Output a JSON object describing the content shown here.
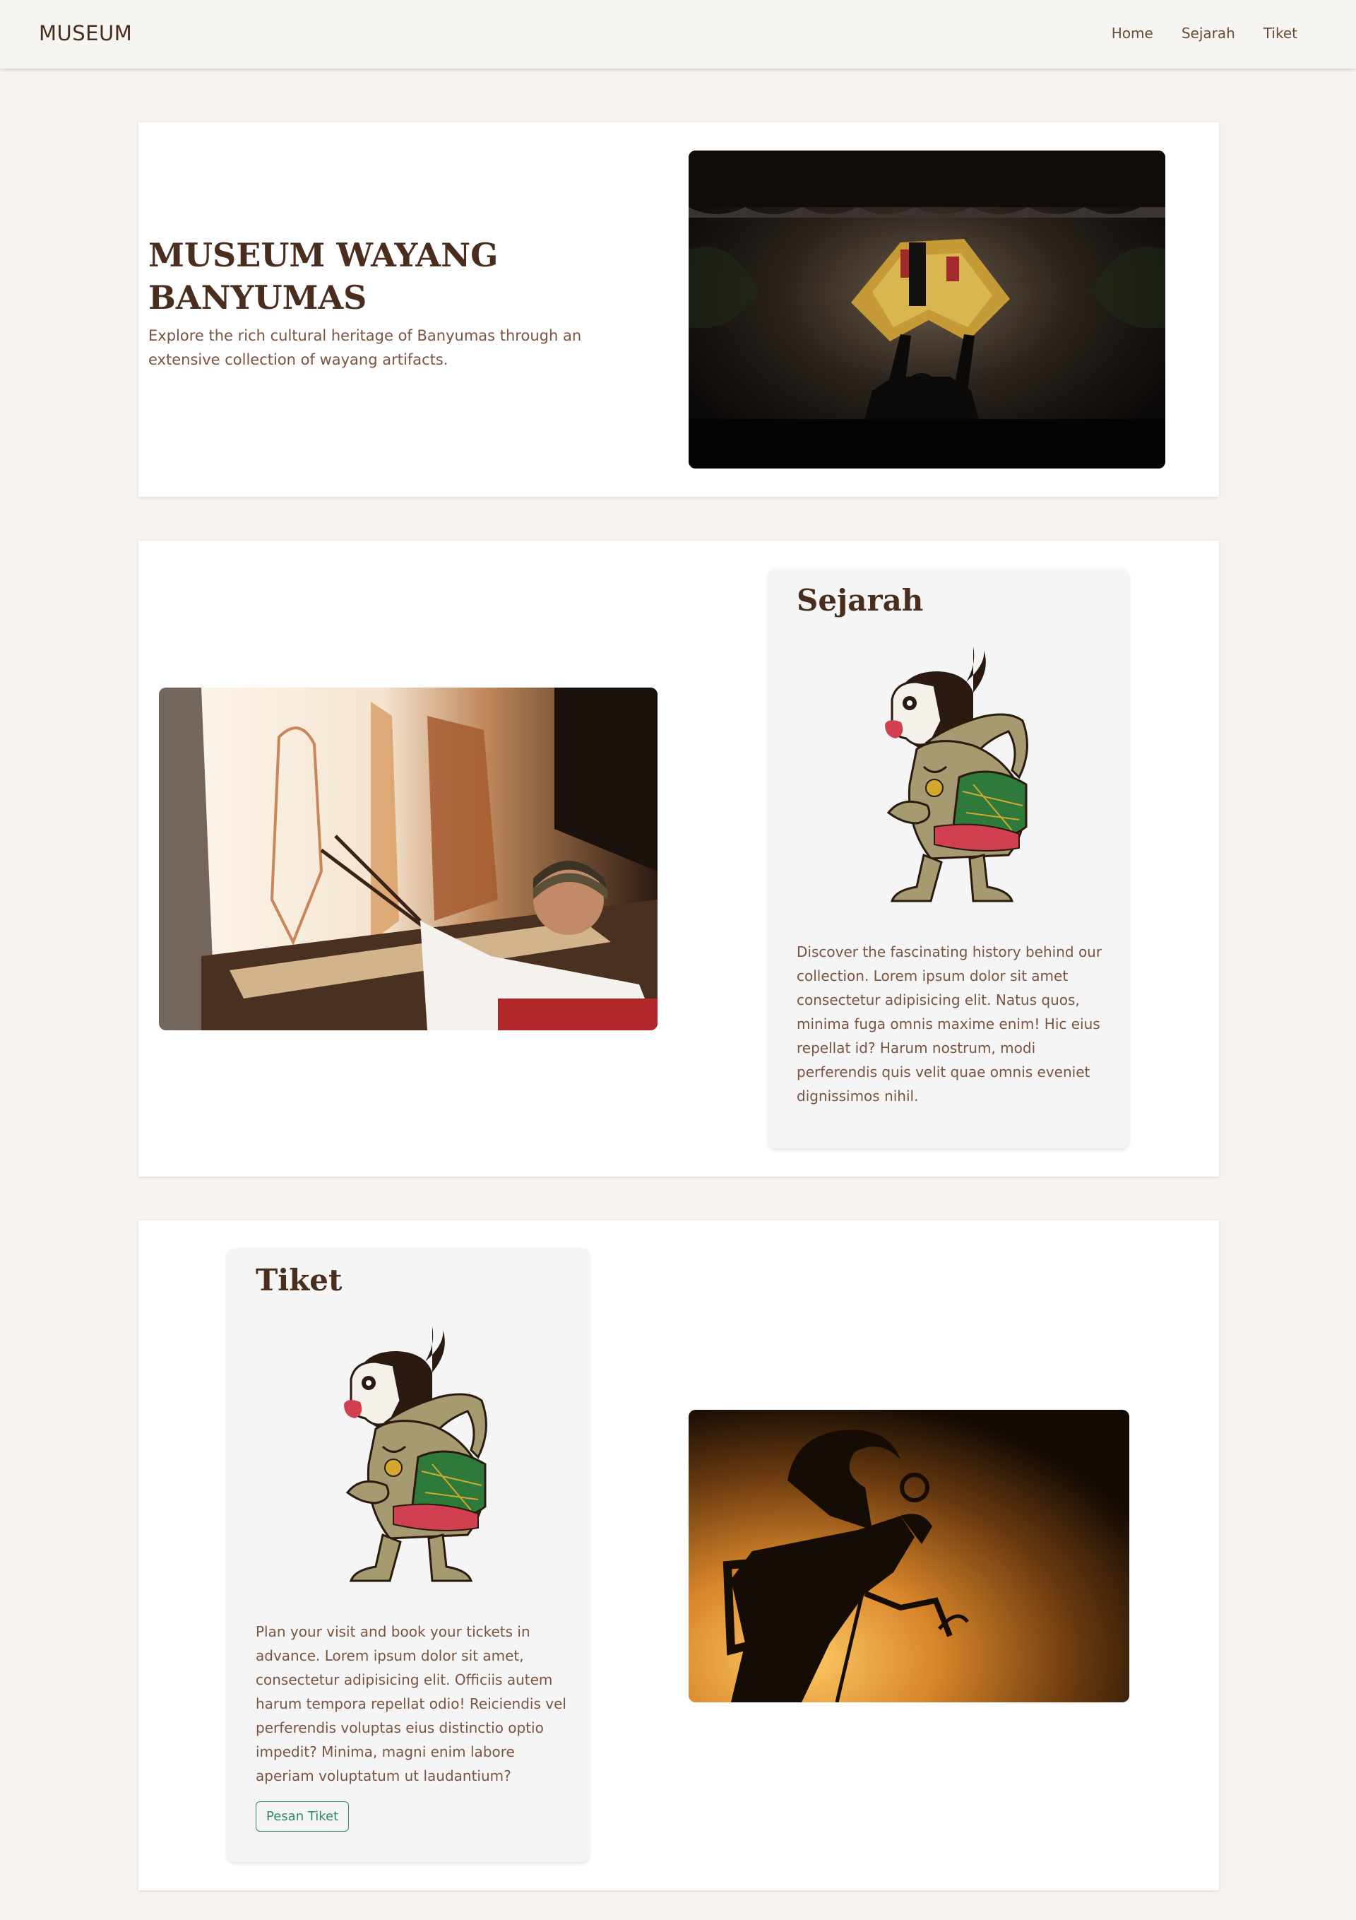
{
  "navbar": {
    "brand": "MUSEUM",
    "links": [
      "Home",
      "Sejarah",
      "Tiket"
    ]
  },
  "hero": {
    "title": "MUSEUM WAYANG BANYUMAS",
    "subtitle": "Explore the rich cultural heritage of Banyumas through an extensive collection of wayang artifacts."
  },
  "sejarah": {
    "title": "Sejarah",
    "text": "Discover the fascinating history behind our collection. Lorem ipsum dolor sit amet consectetur adipisicing elit. Natus quos, minima fuga omnis maxime enim! Hic eius repellat id? Harum nostrum, modi perferendis quis velit quae omnis eveniet dignissimos nihil."
  },
  "tiket": {
    "title": "Tiket",
    "text": "Plan your visit and book your tickets in advance. Lorem ipsum dolor sit amet, consectetur adipisicing elit. Officiis autem harum tempora repellat odio! Reiciendis vel perferendis voluptas eius distinctio optio impedit? Minima, magni enim labore aperiam voluptatum ut laudantium?",
    "button_label": "Pesan Tiket"
  },
  "colors": {
    "background": "#f7f4f0",
    "heading": "#4a2e1d",
    "body_text": "#7a5440",
    "button_accent": "#2e8a6e"
  }
}
